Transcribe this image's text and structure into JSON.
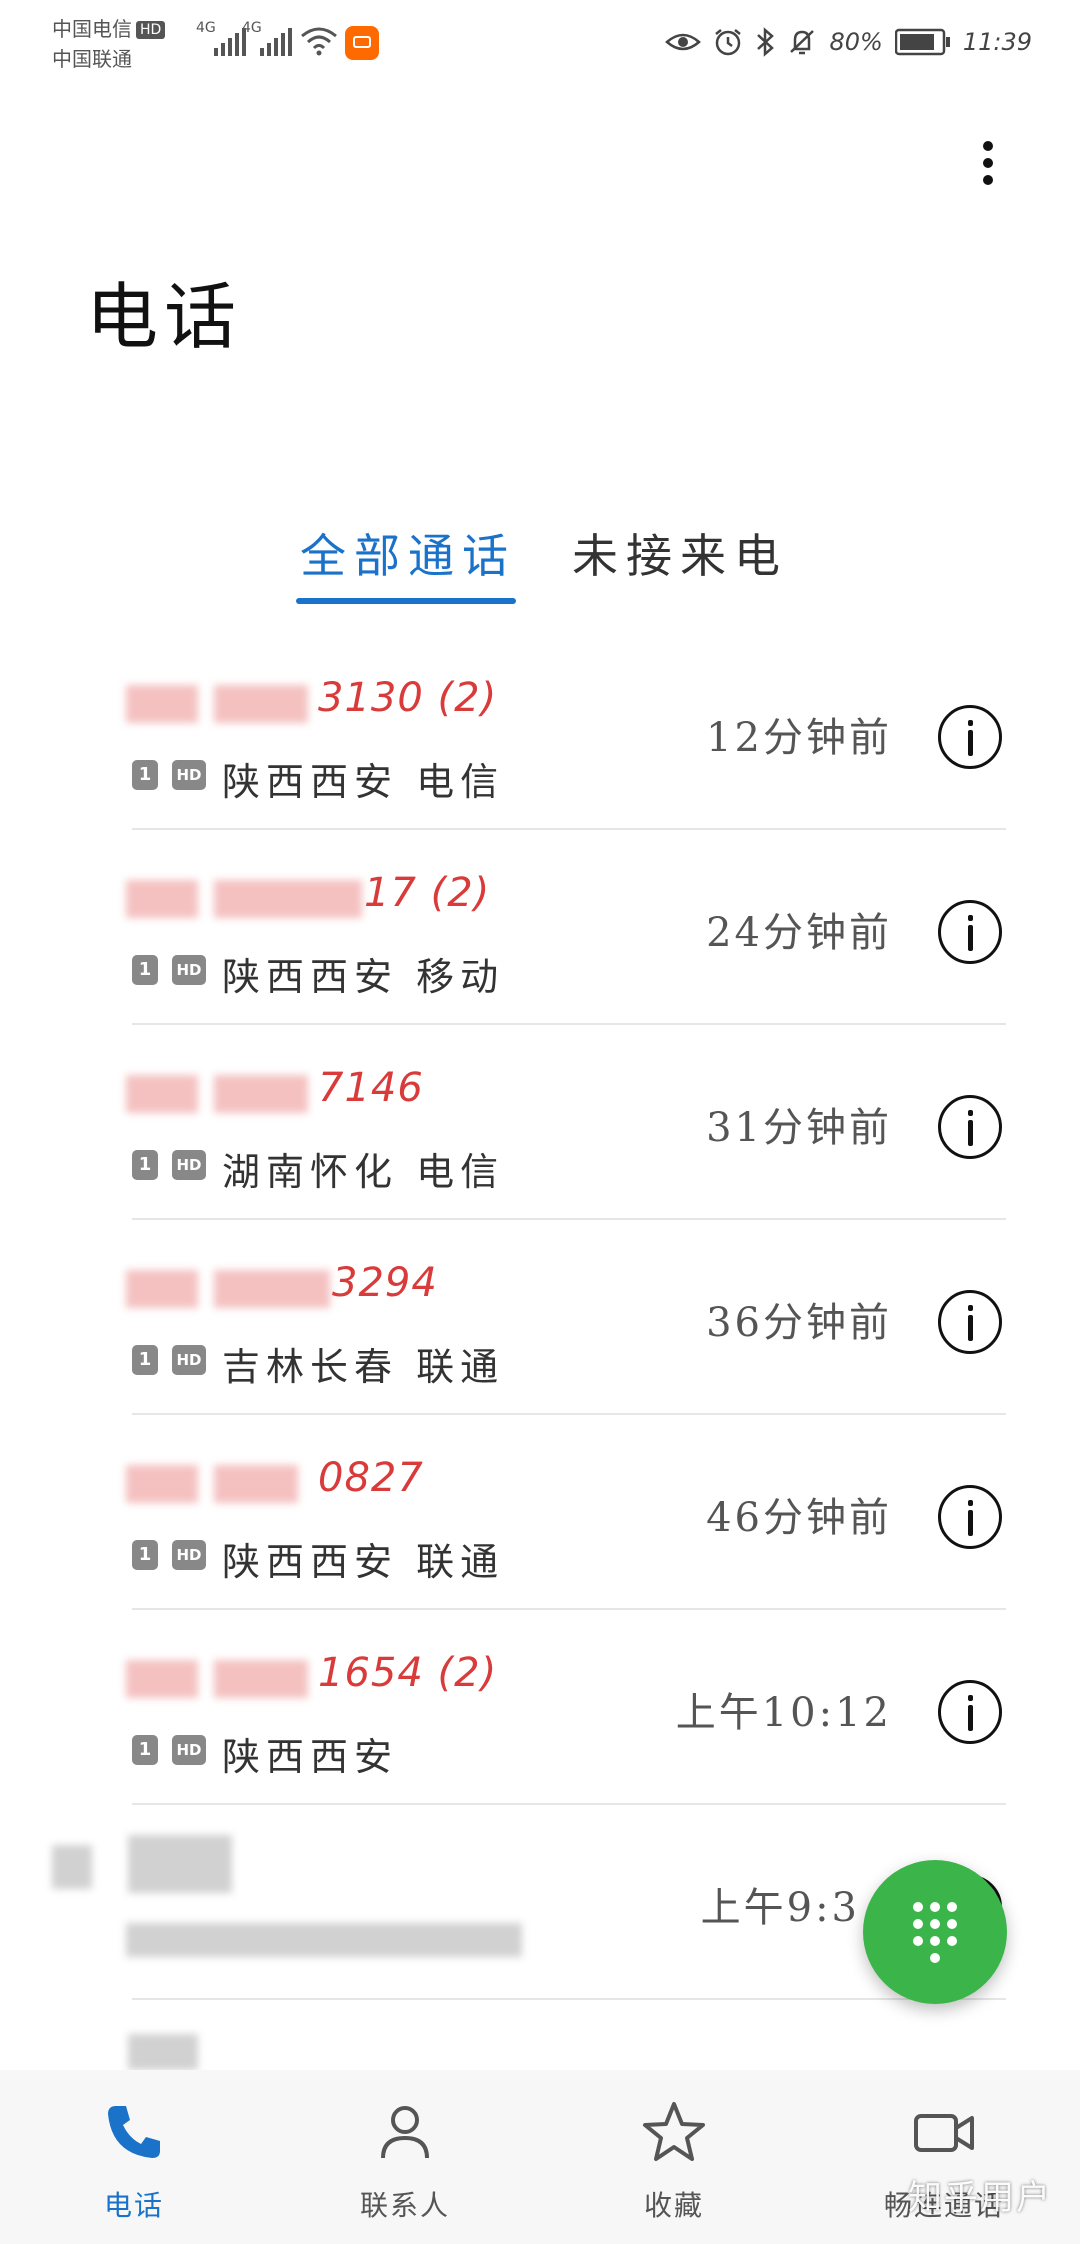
{
  "status_bar": {
    "carrier_1": "中国电信",
    "carrier_1_badge": "HD",
    "carrier_2": "中国联通",
    "network_1": "4G",
    "network_2": "4G",
    "battery_percent": "80%",
    "time": "11:39",
    "icons": [
      "eye-icon",
      "alarm-icon",
      "bluetooth-icon",
      "mute-icon",
      "battery-icon"
    ]
  },
  "header": {
    "title": "电话",
    "more_icon": "more-vertical-icon"
  },
  "tabs": [
    {
      "label": "全部通话",
      "active": true
    },
    {
      "label": "未接来电",
      "active": false
    }
  ],
  "calls": [
    {
      "number_suffix": "3130 (2)",
      "sim": "1",
      "hd": "HD",
      "location": "陕西西安 电信",
      "time": "12分钟前"
    },
    {
      "number_suffix": "17 (2)",
      "sim": "1",
      "hd": "HD",
      "location": "陕西西安 移动",
      "time": "24分钟前"
    },
    {
      "number_suffix": "7146",
      "sim": "1",
      "hd": "HD",
      "location": "湖南怀化 电信",
      "time": "31分钟前"
    },
    {
      "number_suffix": "3294",
      "sim": "1",
      "hd": "HD",
      "location": "吉林长春 联通",
      "time": "36分钟前"
    },
    {
      "number_suffix": "0827",
      "sim": "1",
      "hd": "HD",
      "location": "陕西西安 联通",
      "time": "46分钟前"
    },
    {
      "number_suffix": "1654 (2)",
      "sim": "1",
      "hd": "HD",
      "location": "陕西西安",
      "time": "上午10:12"
    },
    {
      "number_suffix": "",
      "sim": "",
      "hd": "",
      "location": "",
      "time": "上午9:3"
    }
  ],
  "fab": {
    "icon": "dialpad-icon"
  },
  "bottom_nav": [
    {
      "label": "电话",
      "icon": "phone-icon",
      "active": true
    },
    {
      "label": "联系人",
      "icon": "contacts-icon",
      "active": false
    },
    {
      "label": "收藏",
      "icon": "star-icon",
      "active": false
    },
    {
      "label": "畅连通话",
      "icon": "video-call-icon",
      "active": false
    }
  ],
  "watermark": "知乎用户",
  "colors": {
    "accent": "#1a73c8",
    "missed_call": "#d93a3a",
    "fab": "#3bb54a"
  }
}
